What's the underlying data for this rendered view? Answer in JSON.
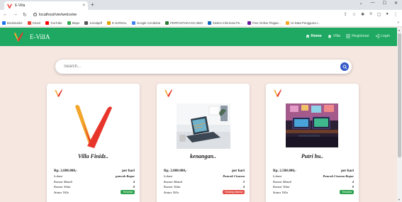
{
  "browser": {
    "tab_title": "E-Villa",
    "url": "localhost/vie/welcome",
    "bookmarks": [
      "Bookmarks",
      "Gmail",
      "YouTube",
      "Maps",
      "Jurnalpdf",
      "E-JURNAL",
      "Google Cendekia",
      "PERPUSTAKAAN UBSI",
      "Sistem Informasi Pe...",
      "Free Online Plagiar...",
      "Isi Data Pengguna I..."
    ],
    "bookmark_colors": [
      "#1a73e8",
      "#ea4335",
      "#ff0000",
      "#34a853",
      "#555555",
      "#e0a100",
      "#4285f4",
      "#2e7d32",
      "#1565c0",
      "#6a1b9a",
      "#f9a825"
    ]
  },
  "navbar": {
    "brand": "E-VillA",
    "links": [
      {
        "label": "Home",
        "icon": "home-icon",
        "active": true
      },
      {
        "label": "Villa",
        "icon": "villa-icon",
        "active": false
      },
      {
        "label": "Registrasi",
        "icon": "register-icon",
        "active": false
      },
      {
        "label": "Login",
        "icon": "login-icon",
        "active": false
      }
    ]
  },
  "search": {
    "placeholder": "Search..."
  },
  "labels": {
    "per_hari": "per hari",
    "lokasi": "Lokasi",
    "kamar_mandi": "Kamar Mandi",
    "kamar_tidur": "Kamar Tidur",
    "status": "Status Villa"
  },
  "cards": [
    {
      "name": "Villa Finidz..",
      "price": "Rp. 2.000.000,-",
      "lokasi": "puncak Bogor",
      "kamar_mandi": "4",
      "kamar_tidur": "8",
      "status": "Tersedia",
      "status_color": "#2ea44f",
      "image": "villa-logo"
    },
    {
      "name": "kenangan..",
      "price": "Rp. 2.000.000,-",
      "lokasi": "Puncak Cisarua",
      "kamar_mandi": "2",
      "kamar_tidur": "4",
      "status": "Sedang disewa",
      "status_color": "#e5534b",
      "image": "laptop-desk-photo"
    },
    {
      "name": "Putri bu..",
      "price": "Rp. 2.500.000,-",
      "lokasi": "Puncak Cisarua Bogor",
      "kamar_mandi": "4",
      "kamar_tidur": "8",
      "status": "Tersedia",
      "status_color": "#2ea44f",
      "image": "gaming-room-photo"
    }
  ],
  "colors": {
    "navbar": "#1ea862",
    "page_bg": "#f7e7e1",
    "search_button": "#3559c7",
    "logo_red": "#e8352b",
    "logo_orange": "#f3a62b"
  }
}
